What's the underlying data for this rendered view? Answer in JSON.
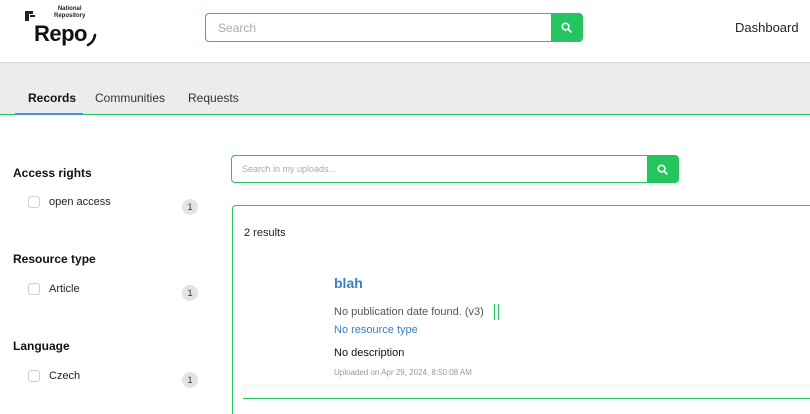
{
  "header": {
    "logo_small_line1": "National",
    "logo_small_line2": "Repository",
    "logo_big": "Repo",
    "search_placeholder": "Search",
    "dashboard_label": "Dashboard"
  },
  "tabs": [
    {
      "label": "Records",
      "active": true
    },
    {
      "label": "Communities",
      "active": false
    },
    {
      "label": "Requests",
      "active": false
    }
  ],
  "uploads_search": {
    "placeholder": "Search in my uploads..."
  },
  "facets": [
    {
      "title": "Access rights",
      "options": [
        {
          "label": "open access",
          "count": "1"
        }
      ]
    },
    {
      "title": "Resource type",
      "options": [
        {
          "label": "Article",
          "count": "1"
        }
      ]
    },
    {
      "title": "Language",
      "options": [
        {
          "label": "Czech",
          "count": "1"
        }
      ]
    }
  ],
  "results": {
    "count_label": "2 results",
    "items": [
      {
        "title": "blah",
        "date": "No publication date found. (v3)",
        "resource_type": "No resource type",
        "description": "No description",
        "uploaded": "Uploaded on Apr 29, 2024, 8:50:08 AM"
      }
    ]
  },
  "colors": {
    "accent": "#22c55e",
    "link": "#3b7fc4",
    "tab_underline": "#4a90d9"
  },
  "icons": {
    "search": "search-icon",
    "logo": "logo-icon"
  }
}
